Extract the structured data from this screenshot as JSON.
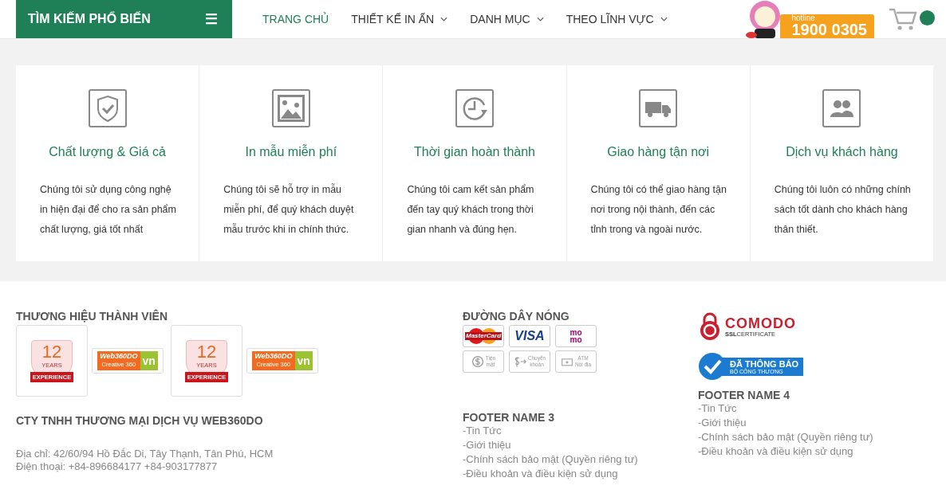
{
  "header": {
    "category_button": "TÌM KIẾM PHỔ BIẾN",
    "menu_icon": "☰",
    "nav": [
      {
        "label": "TRANG CHỦ",
        "selected": true,
        "dropdown": false
      },
      {
        "label": "THIẾT KẾ IN ẤN",
        "selected": false,
        "dropdown": true
      },
      {
        "label": "DANH MỤC",
        "selected": false,
        "dropdown": true
      },
      {
        "label": "THEO LĨNH VỰC",
        "selected": false,
        "dropdown": true
      }
    ],
    "hotline": {
      "label": "hotline",
      "number": "1900 0305"
    }
  },
  "features": [
    {
      "kind": "shield",
      "title": "Chất lượng & Giá cả",
      "text": "Chúng tôi sử dụng công nghệ in hiện đại để cho ra sản phẩm chất lượng, giá tốt nhất"
    },
    {
      "kind": "image",
      "title": "In mẫu miễn phí",
      "text": "Chúng tôi sẽ hỗ trợ in mẫu miễn phí, để quý khách duyệt mẫu trước khi in chính thức."
    },
    {
      "kind": "clock",
      "title": "Thời gian hoàn thành",
      "text": "Chúng tôi cam kết sản phẩm đến tay quý khách trong thời gian nhanh và đúng hẹn."
    },
    {
      "kind": "truck",
      "title": "Giao hàng tận nơi",
      "text": "Chúng tôi có thể giao hàng tận nơi trong nội thành, đến các tỉnh trong và ngoài nước."
    },
    {
      "kind": "users",
      "title": "Dịch vụ khách hàng",
      "text": "Chúng tôi luôn có những chính sách tốt dành cho khách hàng thân thiết."
    }
  ],
  "footer": {
    "brands": {
      "title": "THƯƠNG HIỆU THÀNH VIÊN",
      "items": [
        {
          "badge": {
            "number": "12",
            "years": "YEARS",
            "ribbon": "EXPERIENCE"
          },
          "logo": {
            "name": "Web360DO",
            "tagline": "Creative 360",
            "tld": "vn"
          }
        },
        {
          "badge": {
            "number": "12",
            "years": "YEARS",
            "ribbon": "EXPERIENCE"
          },
          "logo": {
            "name": "Web360DO",
            "tagline": "Creative 360",
            "tld": "vn"
          }
        }
      ]
    },
    "company": "CTY TNHH THƯƠNG MẠI DỊCH VỤ WEB360DO",
    "address": "Địa chỉ: 42/60/94 Hồ Đắc Di, Tây Thạnh, Tân Phú, HCM",
    "phone": "Điện thoại: +84-896684177  +84-903177877",
    "hotline_title": "ĐƯỜNG DÂY NÓNG",
    "payments": [
      {
        "kind": "mastercard",
        "lines": [
          "MasterCard"
        ]
      },
      {
        "kind": "visa",
        "lines": [
          "VISA"
        ]
      },
      {
        "kind": "momo",
        "lines": [
          "mo",
          "mo"
        ]
      },
      {
        "kind": "cash",
        "lines": [
          "Tiện",
          "mặt"
        ]
      },
      {
        "kind": "transfer",
        "lines": [
          "Chuyển",
          "khoản"
        ]
      },
      {
        "kind": "atm",
        "lines": [
          "ATM",
          "Nội địa"
        ]
      }
    ],
    "col3": {
      "title": "FOOTER NAME 3",
      "links": [
        "-Tin Tức",
        "-Giới thiệu",
        "-Chính sách bảo mật (Quyền riêng tư)",
        "-Điều khoản và điều kiện sử dụng"
      ]
    },
    "comodo": {
      "name": "COMODO",
      "sub_bold": "SSL",
      "sub": "CERTIFICATE"
    },
    "bct": {
      "top": "ĐÃ THÔNG BÁO",
      "bottom": "BỘ CÔNG THƯƠNG"
    },
    "col4": {
      "title": "FOOTER NAME 4",
      "links": [
        "-Tin Tức",
        "-Giới thiệu",
        "-Chính sách bảo mật (Quyền riêng tư)",
        "-Điều khoản và điều kiện sử dụng"
      ]
    }
  }
}
